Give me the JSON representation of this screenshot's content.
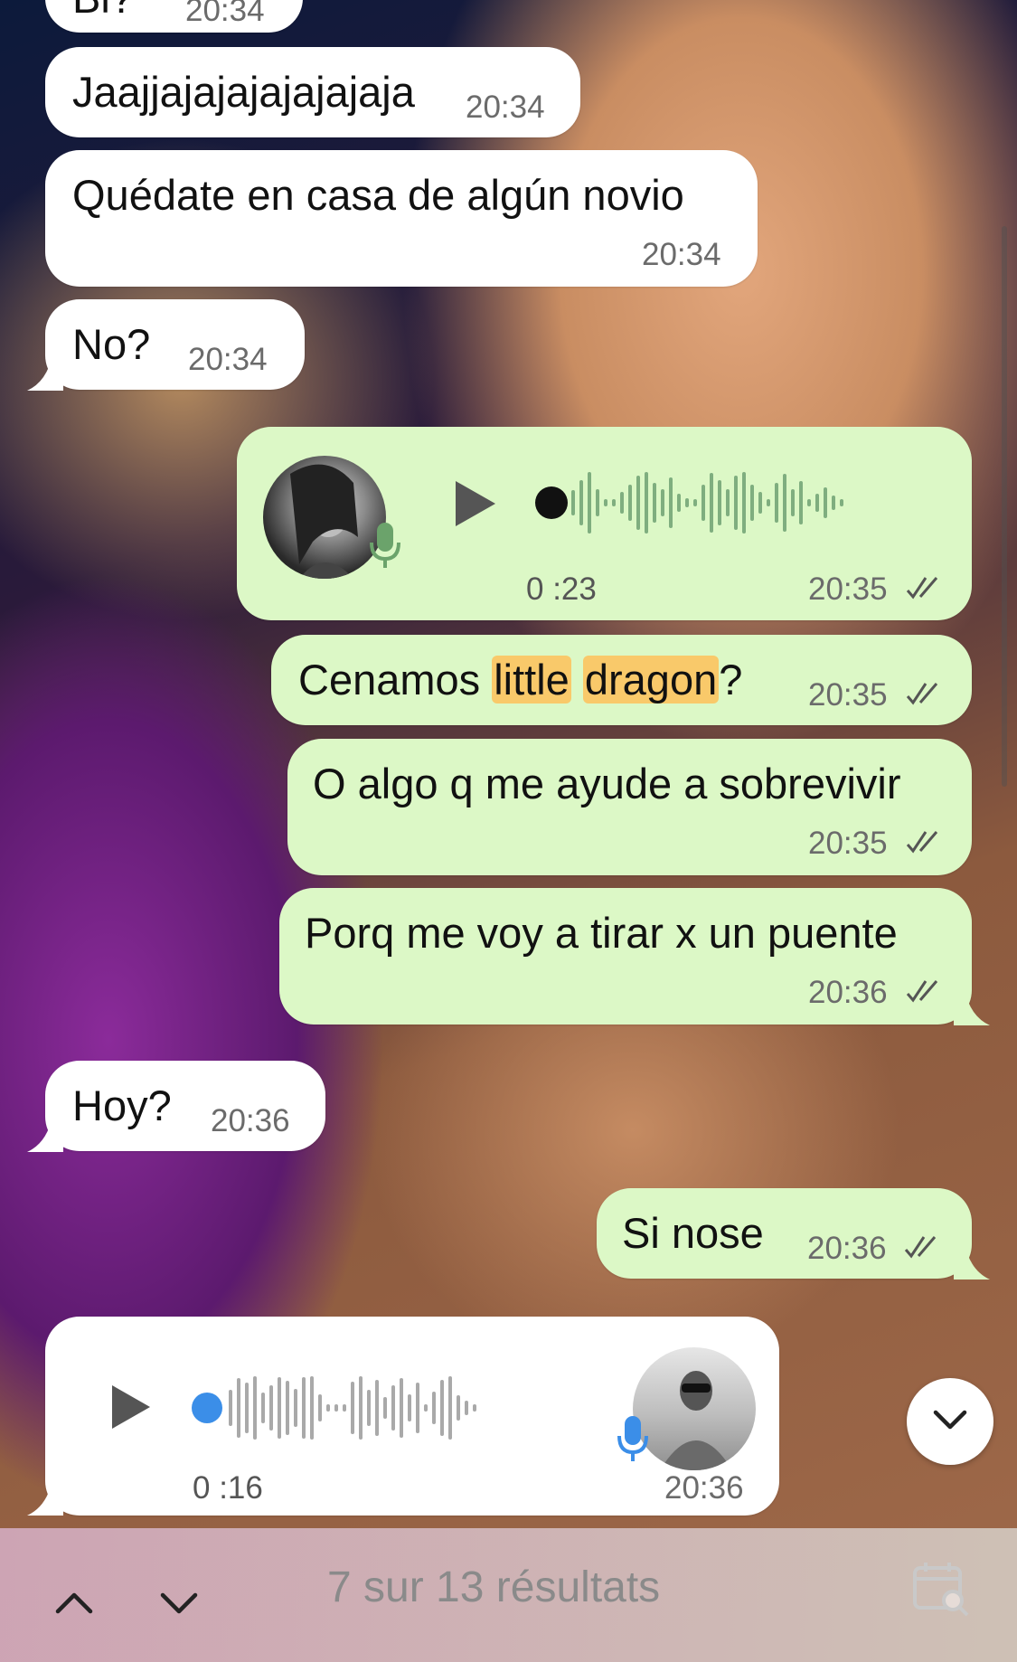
{
  "messages": [
    {
      "id": "m0",
      "text": "Bl?",
      "time": "20:34"
    },
    {
      "id": "m1",
      "text": "Jaajjajajajajajajaja",
      "time": "20:34"
    },
    {
      "id": "m2",
      "text": "Quédate en casa de algún novio",
      "time": "20:34"
    },
    {
      "id": "m3",
      "text": "No?",
      "time": "20:34"
    },
    {
      "id": "m4",
      "type": "voice",
      "duration": "0 :23",
      "time": "20:35"
    },
    {
      "id": "m5",
      "text_before": "Cenamos ",
      "highlight1": "little",
      "space": " ",
      "highlight2": "dragon",
      "text_after": "?",
      "time": "20:35"
    },
    {
      "id": "m6",
      "text": "O algo q me ayude a sobrevivir",
      "time": "20:35"
    },
    {
      "id": "m7",
      "text": "Porq me voy a tirar x un puente",
      "time": "20:36"
    },
    {
      "id": "m8",
      "text": "Hoy?",
      "time": "20:36"
    },
    {
      "id": "m9",
      "text": "Si nose",
      "time": "20:36"
    },
    {
      "id": "m10",
      "type": "voice",
      "duration": "0 :16",
      "time": "20:36"
    }
  ],
  "search": {
    "results_label": "7 sur 13 résultats"
  },
  "colors": {
    "incoming": "#ffffff",
    "outgoing": "#dcf8c6",
    "highlight": "#f9c96a",
    "mic_blue": "#3b8ee8",
    "mic_green": "#6ba36b"
  }
}
